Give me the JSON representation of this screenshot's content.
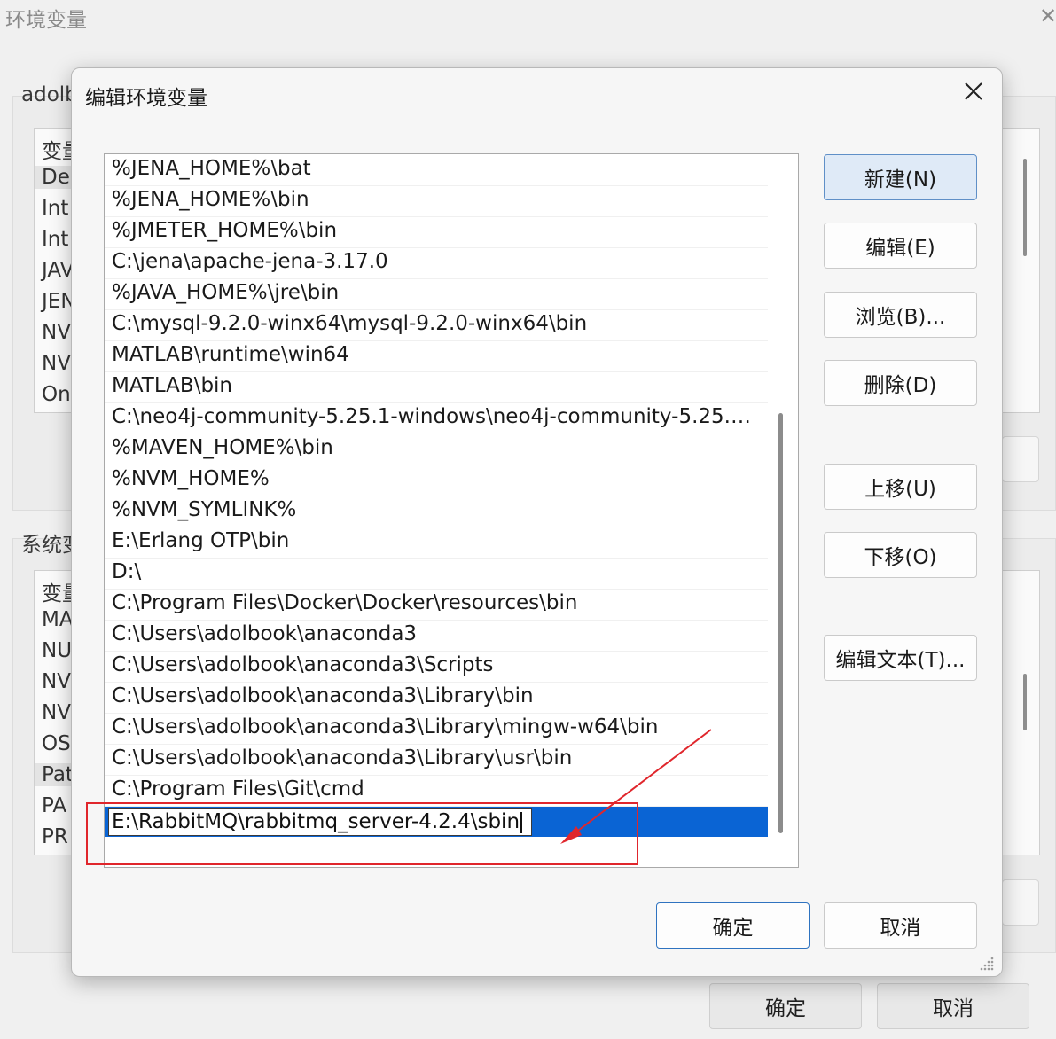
{
  "background_window": {
    "title": "环境变量",
    "user_group_label": "adolb",
    "sys_group_label": "系统变",
    "user_rows": [
      "变量",
      "De",
      "Int",
      "Int",
      "JAV",
      "JEN",
      "NV",
      "NV",
      "On"
    ],
    "sys_rows": [
      "变量",
      "MA",
      "NU",
      "NV",
      "NV",
      "OS",
      "Pat",
      "PA",
      "PR"
    ],
    "ok_label": "确定",
    "cancel_label": "取消"
  },
  "dialog": {
    "title": "编辑环境变量",
    "paths": [
      "%JENA_HOME%\\bat",
      "%JENA_HOME%\\bin",
      "%JMETER_HOME%\\bin",
      "C:\\jena\\apache-jena-3.17.0",
      "%JAVA_HOME%\\jre\\bin",
      "C:\\mysql-9.2.0-winx64\\mysql-9.2.0-winx64\\bin",
      "MATLAB\\runtime\\win64",
      "MATLAB\\bin",
      "C:\\neo4j-community-5.25.1-windows\\neo4j-community-5.25.1...",
      "%MAVEN_HOME%\\bin",
      "%NVM_HOME%",
      "%NVM_SYMLINK%",
      "E:\\Erlang OTP\\bin",
      "D:\\",
      "C:\\Program Files\\Docker\\Docker\\resources\\bin",
      "C:\\Users\\adolbook\\anaconda3",
      "C:\\Users\\adolbook\\anaconda3\\Scripts",
      "C:\\Users\\adolbook\\anaconda3\\Library\\bin",
      "C:\\Users\\adolbook\\anaconda3\\Library\\mingw-w64\\bin",
      "C:\\Users\\adolbook\\anaconda3\\Library\\usr\\bin",
      "C:\\Program Files\\Git\\cmd"
    ],
    "editing_value": "E:\\RabbitMQ\\rabbitmq_server-4.2.4\\sbin",
    "buttons": {
      "new": "新建(N)",
      "edit": "编辑(E)",
      "browse": "浏览(B)...",
      "delete": "删除(D)",
      "move_up": "上移(U)",
      "move_down": "下移(O)",
      "edit_text": "编辑文本(T)...",
      "ok": "确定",
      "cancel": "取消"
    }
  },
  "colors": {
    "selection": "#0a64d4",
    "annotation": "#e0262c"
  }
}
